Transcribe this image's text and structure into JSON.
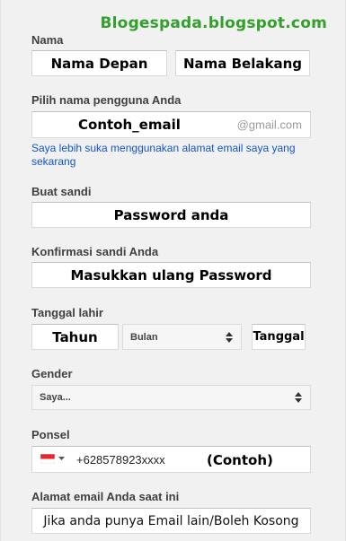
{
  "watermark": "Blogespada.blogspot.com",
  "nama": {
    "label": "Nama",
    "first_value": "Nama Depan",
    "last_value": "Nama Belakang"
  },
  "username": {
    "label": "Pilih nama pengguna Anda",
    "value": "Contoh_email",
    "suffix": "@gmail.com",
    "link": "Saya lebih suka menggunakan alamat email saya yang sekarang"
  },
  "password": {
    "label": "Buat sandi",
    "value": "Password anda"
  },
  "confirm": {
    "label": "Konfirmasi sandi Anda",
    "value": "Masukkan ulang Password"
  },
  "birth": {
    "label": "Tanggal lahir",
    "year_value": "Tahun",
    "month_selected": "Bulan",
    "day_value": "Tanggal"
  },
  "gender": {
    "label": "Gender",
    "selected": "Saya..."
  },
  "phone": {
    "label": "Ponsel",
    "value": "+628578923xxxx",
    "note": "(Contoh)",
    "flag_icon": "indonesia-flag-icon"
  },
  "current_email": {
    "label": "Alamat email Anda saat ini",
    "value": "Jika anda punya Email lain/Boleh Kosong"
  },
  "colors": {
    "watermark": "#33a02c",
    "link": "#1155cc",
    "label": "#404040",
    "flag_red": "#e8262b"
  }
}
